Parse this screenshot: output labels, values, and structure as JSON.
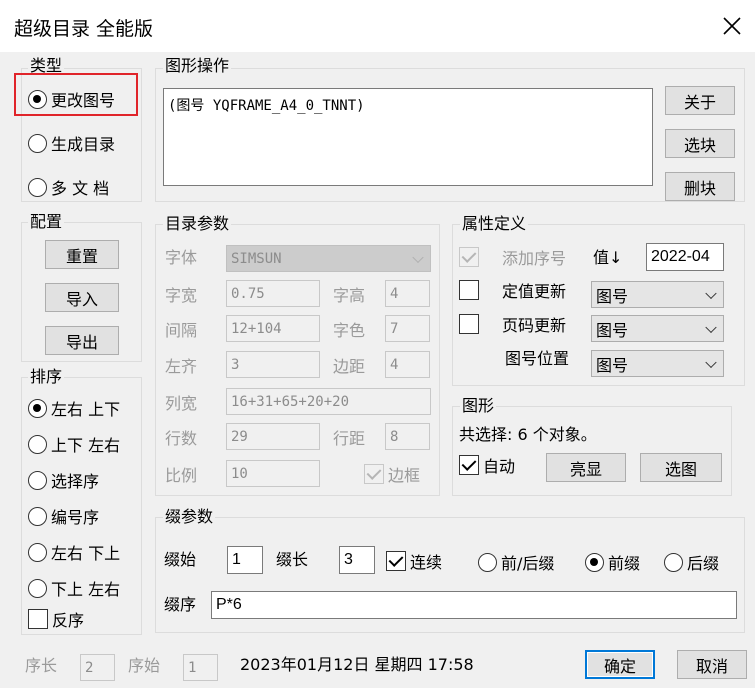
{
  "window": {
    "title": "超级目录 全能版"
  },
  "type_group": {
    "legend": "类型",
    "options": [
      {
        "label": "更改图号",
        "selected": true
      },
      {
        "label": "生成目录",
        "selected": false
      },
      {
        "label": "多 文 档",
        "selected": false
      }
    ]
  },
  "graphic_ops": {
    "legend": "图形操作",
    "text": "(图号 YQFRAME_A4_0_TNNT)",
    "buttons": [
      "关于",
      "选块",
      "删块"
    ]
  },
  "config": {
    "legend": "配置",
    "buttons": [
      "重置",
      "导入",
      "导出"
    ]
  },
  "sort": {
    "legend": "排序",
    "options": [
      {
        "label": "左右 上下",
        "selected": true
      },
      {
        "label": "上下 左右",
        "selected": false
      },
      {
        "label": "选择序",
        "selected": false
      },
      {
        "label": "编号序",
        "selected": false
      },
      {
        "label": "左右 下上",
        "selected": false
      },
      {
        "label": "下上 左右",
        "selected": false
      }
    ],
    "reverse": {
      "label": "反序",
      "checked": false
    }
  },
  "catalog_params": {
    "legend": "目录参数",
    "font_label": "字体",
    "font_value": "SIMSUN",
    "width_label": "字宽",
    "width_value": "0.75",
    "height_label": "字高",
    "height_value": "4",
    "spacing_label": "间隔",
    "spacing_value": "12+104",
    "color_label": "字色",
    "color_value": "7",
    "left_label": "左齐",
    "left_value": "3",
    "margin_label": "边距",
    "margin_value": "4",
    "colwidth_label": "列宽",
    "colwidth_value": "16+31+65+20+20",
    "rowcount_label": "行数",
    "rowcount_value": "29",
    "rowspace_label": "行距",
    "rowspace_value": "8",
    "scale_label": "比例",
    "scale_value": "10",
    "border_label": "边框",
    "border_checked": true
  },
  "attr_def": {
    "legend": "属性定义",
    "add_seq_label": "添加序号",
    "add_seq_checked": true,
    "value_label": "值↓",
    "value": "2022-04",
    "fixed_update_label": "定值更新",
    "fixed_update_checked": false,
    "fixed_update_select": "图号",
    "page_update_label": "页码更新",
    "page_update_checked": false,
    "page_update_select": "图号",
    "pos_label": "图号位置",
    "pos_select": "图号"
  },
  "graphic": {
    "legend": "图形",
    "selection_text": "共选择: 6 个对象。",
    "auto_label": "自动",
    "auto_checked": true,
    "highlight_btn": "亮显",
    "select_btn": "选图"
  },
  "level_params": {
    "legend": "缀参数",
    "start_label": "缀始",
    "start_value": "1",
    "length_label": "缀长",
    "length_value": "3",
    "continuous_label": "连续",
    "continuous_checked": true,
    "options": [
      {
        "label": "前/后缀",
        "selected": false
      },
      {
        "label": "前缀",
        "selected": true
      },
      {
        "label": "后缀",
        "selected": false
      }
    ],
    "order_label": "缀序",
    "order_value": "P*6"
  },
  "footer": {
    "seq_len_label": "序长",
    "seq_len_value": "2",
    "seq_start_label": "序始",
    "seq_start_value": "1",
    "datetime": "2023年01月12日 星期四 17:58",
    "ok": "确定",
    "cancel": "取消"
  }
}
